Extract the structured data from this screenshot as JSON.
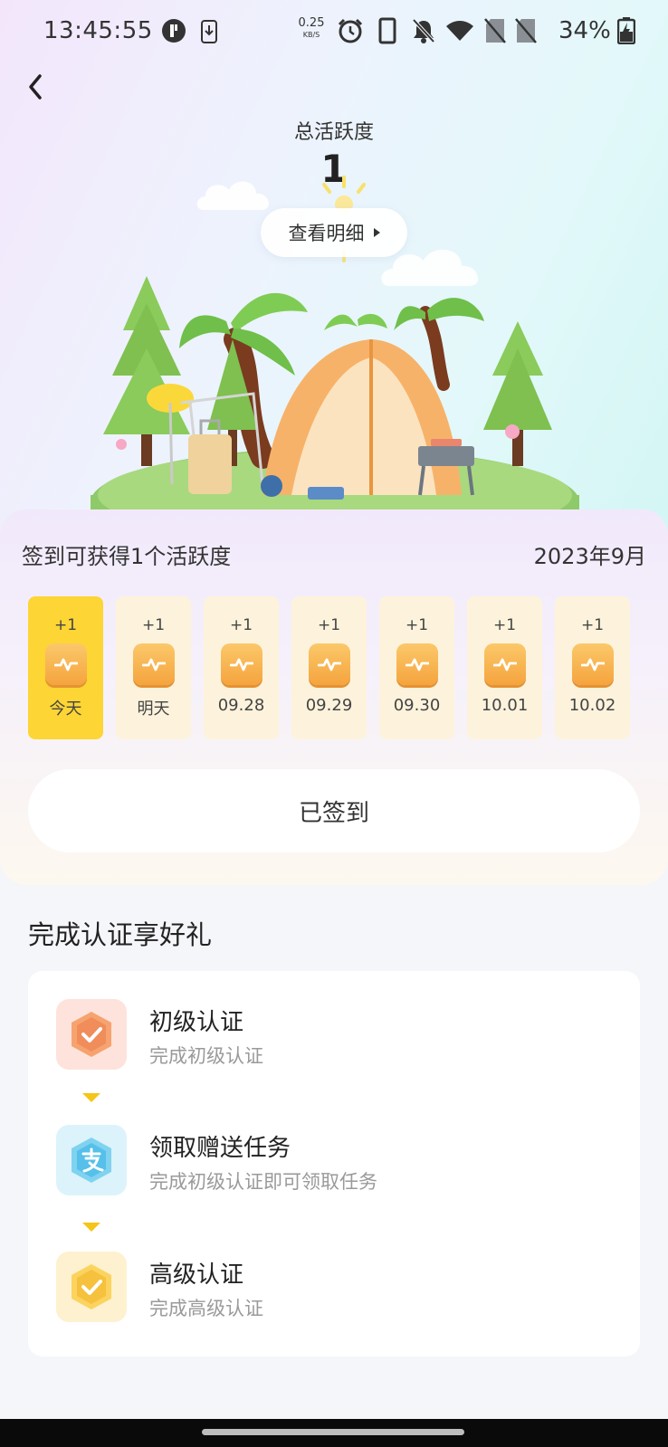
{
  "status_bar": {
    "time": "13:45:55",
    "net_speed_value": "0.25",
    "net_speed_unit": "KB/S",
    "battery": "34%",
    "icons": [
      "profile-icon",
      "download-icon",
      "alarm-icon",
      "phone-icon",
      "mute-bell-icon",
      "wifi-icon",
      "no-sim-icon",
      "no-sim-icon",
      "battery-charging-icon"
    ]
  },
  "header": {
    "back_icon": "back-chevron-icon",
    "title": "总活跃度",
    "total_activity": "1",
    "detail_button": "查看明细"
  },
  "checkin": {
    "title": "签到可获得1个活跃度",
    "month": "2023年9月",
    "days": [
      {
        "reward": "+1",
        "label": "今天",
        "today": true
      },
      {
        "reward": "+1",
        "label": "明天",
        "today": false
      },
      {
        "reward": "+1",
        "label": "09.28",
        "today": false
      },
      {
        "reward": "+1",
        "label": "09.29",
        "today": false
      },
      {
        "reward": "+1",
        "label": "09.30",
        "today": false
      },
      {
        "reward": "+1",
        "label": "10.01",
        "today": false
      },
      {
        "reward": "+1",
        "label": "10.02",
        "today": false
      }
    ],
    "button": "已签到"
  },
  "certification": {
    "section_title": "完成认证享好礼",
    "items": [
      {
        "title": "初级认证",
        "subtitle": "完成初级认证",
        "icon": "shield-check-icon"
      },
      {
        "title": "领取赠送任务",
        "subtitle": "完成初级认证即可领取任务",
        "icon": "alipay-icon"
      },
      {
        "title": "高级认证",
        "subtitle": "完成高级认证",
        "icon": "shield-check-icon"
      }
    ]
  },
  "colors": {
    "today_bg": "#fdd535",
    "day_bg": "#fdf3dc",
    "badge": "#f5a43e",
    "connector": "#f5c518"
  }
}
